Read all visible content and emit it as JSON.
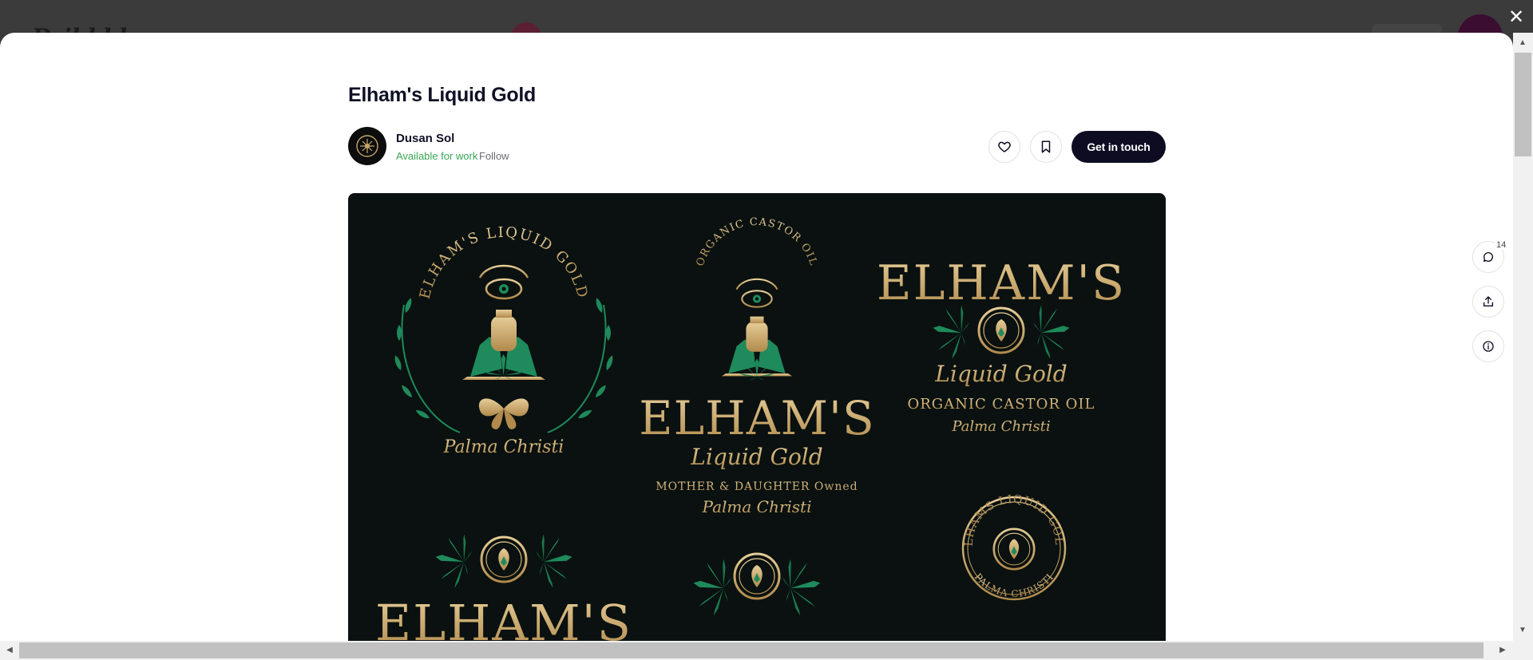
{
  "under_page": {
    "logo_text": "Dribbble"
  },
  "close_label": "✕",
  "shot": {
    "title": "Elham's Liquid Gold",
    "author": {
      "name": "Dusan Sol",
      "status": "Available for work",
      "follow_label": "Follow"
    },
    "actions": {
      "like_icon": "heart-icon",
      "save_icon": "bookmark-icon",
      "cta_label": "Get in touch"
    },
    "comments_count": "14"
  },
  "artwork": {
    "badge1_arc": "ELHAM'S LIQUID GOLD",
    "badge1_script": "Palma Christi",
    "badge2_arc": "ORGANIC CASTOR OIL",
    "badge2_name": "ELHAM'S",
    "badge2_script": "Liquid Gold",
    "badge2_line": "MOTHER & DAUGHTER Owned",
    "badge2_script2": "Palma Christi",
    "badge3_name": "ELHAM'S",
    "badge3_script": "Liquid Gold",
    "badge3_line": "ORGANIC CASTOR OIL",
    "badge3_script2": "Palma Christi",
    "seal_top": "ELHAMS LIQUID GOLD",
    "seal_bottom": "PALMA CHRISTI",
    "badge4_name": "ELHAM'S"
  },
  "colors": {
    "gold": "#c9a76a",
    "green": "#1f8a5b",
    "bg": "#0a1110",
    "cta": "#0d0c22",
    "available": "#3aa655"
  }
}
